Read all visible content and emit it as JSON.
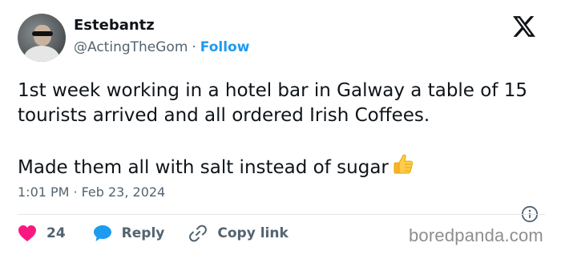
{
  "author": {
    "name": "Estebantz",
    "handle": "@ActingTheGom",
    "separator": "·",
    "follow_label": "Follow",
    "avatar_icon": "avatar"
  },
  "platform": {
    "logo_icon": "x-logo-icon"
  },
  "tweet": {
    "line1": "1st week working in a hotel bar in Galway a table of 15 tourists arrived and all ordered Irish Coffees.",
    "line2": "Made them all with salt instead of sugar",
    "emoji_icon": "thumbs-up-icon"
  },
  "meta": {
    "time": "1:01 PM",
    "separator": "·",
    "date": "Feb 23, 2024",
    "info_icon": "info-icon"
  },
  "actions": {
    "like_count": "24",
    "reply_label": "Reply",
    "copy_link_label": "Copy link"
  },
  "watermark": "boredpanda.com",
  "colors": {
    "text": "#0f1419",
    "secondary": "#536471",
    "accent": "#1d9bf0",
    "like": "#f91880"
  }
}
